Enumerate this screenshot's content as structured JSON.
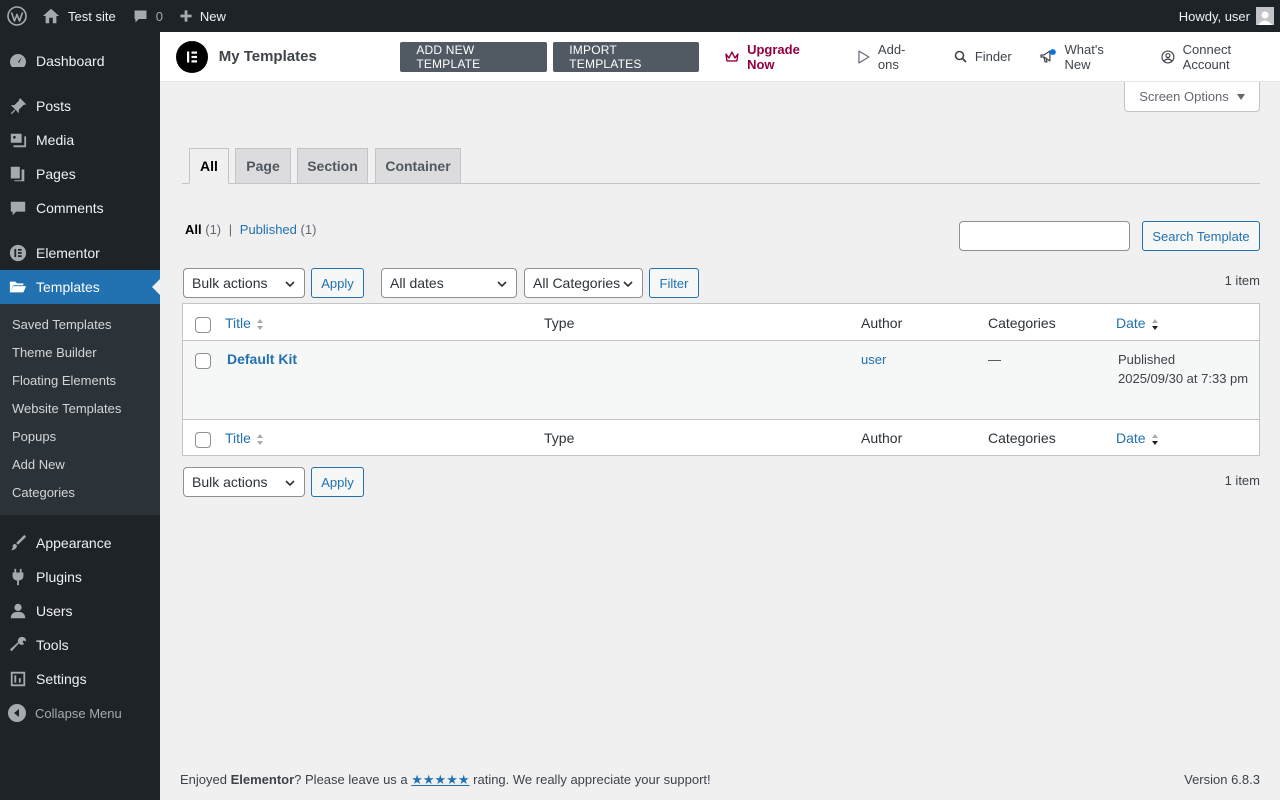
{
  "adminbar": {
    "site_name": "Test site",
    "comments_count": "0",
    "new_label": "New",
    "howdy": "Howdy, user"
  },
  "sidebar": {
    "items_top": [
      {
        "label": "Dashboard",
        "icon": "dashboard-icon"
      },
      {
        "label": "Posts",
        "icon": "pin-icon"
      },
      {
        "label": "Media",
        "icon": "media-icon"
      },
      {
        "label": "Pages",
        "icon": "pages-icon"
      },
      {
        "label": "Comments",
        "icon": "comment-icon"
      },
      {
        "label": "Elementor",
        "icon": "elementor-icon"
      },
      {
        "label": "Templates",
        "icon": "folder-icon"
      }
    ],
    "submenu": [
      "Saved Templates",
      "Theme Builder",
      "Floating Elements",
      "Website Templates",
      "Popups",
      "Add New",
      "Categories"
    ],
    "items_bottom": [
      {
        "label": "Appearance",
        "icon": "brush-icon"
      },
      {
        "label": "Plugins",
        "icon": "plug-icon"
      },
      {
        "label": "Users",
        "icon": "user-icon"
      },
      {
        "label": "Tools",
        "icon": "wrench-icon"
      },
      {
        "label": "Settings",
        "icon": "settings-icon"
      }
    ],
    "collapse_label": "Collapse Menu"
  },
  "header": {
    "title": "My Templates",
    "add_new": "Add New Template",
    "import": "Import Templates",
    "upgrade": "Upgrade Now",
    "addons": "Add-ons",
    "finder": "Finder",
    "whats_new": "What's New",
    "connect": "Connect Account"
  },
  "screen_options": "Screen Options",
  "tabs": [
    "All",
    "Page",
    "Section",
    "Container"
  ],
  "views": {
    "all_label": "All",
    "all_count": "(1)",
    "sep": "|",
    "published_label": "Published",
    "published_count": "(1)"
  },
  "search": {
    "button": "Search Template",
    "value": ""
  },
  "toolbar": {
    "bulk_actions": "Bulk actions",
    "apply": "Apply",
    "dates": "All dates",
    "categories": "All Categories",
    "filter": "Filter",
    "item_count": "1 item"
  },
  "table": {
    "columns": [
      "Title",
      "Type",
      "Author",
      "Categories",
      "Date"
    ],
    "rows": [
      {
        "title": "Default Kit",
        "type": "",
        "author": "user",
        "categories": "—",
        "status": "Published",
        "date": "2025/09/30 at 7:33 pm"
      }
    ]
  },
  "footer": {
    "pre": "Enjoyed ",
    "brand": "Elementor",
    "mid": "? Please leave us a ",
    "stars": "★★★★★",
    "post": " rating. We really appreciate your support!",
    "version": "Version 6.8.3"
  },
  "colors": {
    "accent": "#2271b1",
    "admin_dark": "#1d2327",
    "upgrade": "#93003f"
  }
}
